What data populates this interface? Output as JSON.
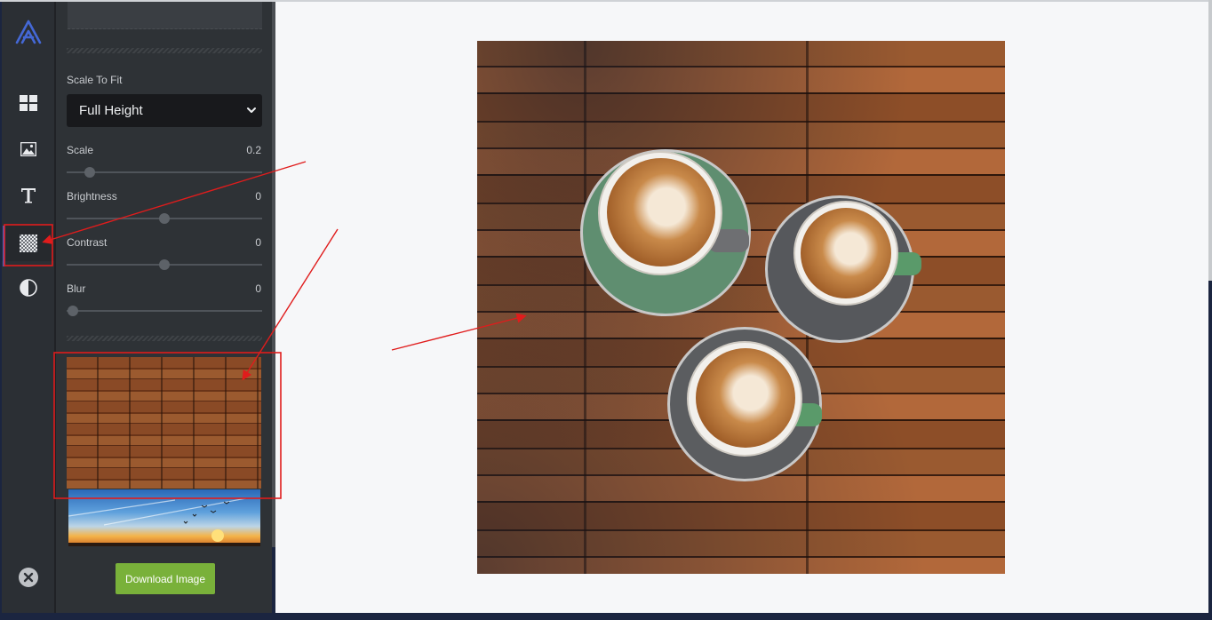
{
  "panel": {
    "scale_to_fit_label": "Scale To Fit",
    "scale_to_fit_value": "Full Height",
    "sliders": [
      {
        "label": "Scale",
        "value": "0.2",
        "level": 0.12
      },
      {
        "label": "Brightness",
        "value": "0",
        "level": 0.5
      },
      {
        "label": "Contrast",
        "value": "0",
        "level": 0.5
      },
      {
        "label": "Blur",
        "value": "0",
        "level": 0.03
      }
    ],
    "download_label": "Download Image"
  },
  "rail": {
    "items": [
      {
        "icon": "logo-icon"
      },
      {
        "icon": "templates-icon"
      },
      {
        "icon": "image-icon"
      },
      {
        "icon": "text-icon"
      },
      {
        "icon": "background-icon",
        "active": true
      },
      {
        "icon": "filter-icon"
      },
      {
        "icon": "close-icon"
      }
    ]
  },
  "colors": {
    "accent": "#4462c9",
    "download_button": "#79b13a",
    "annotation": "#e01c1c"
  }
}
